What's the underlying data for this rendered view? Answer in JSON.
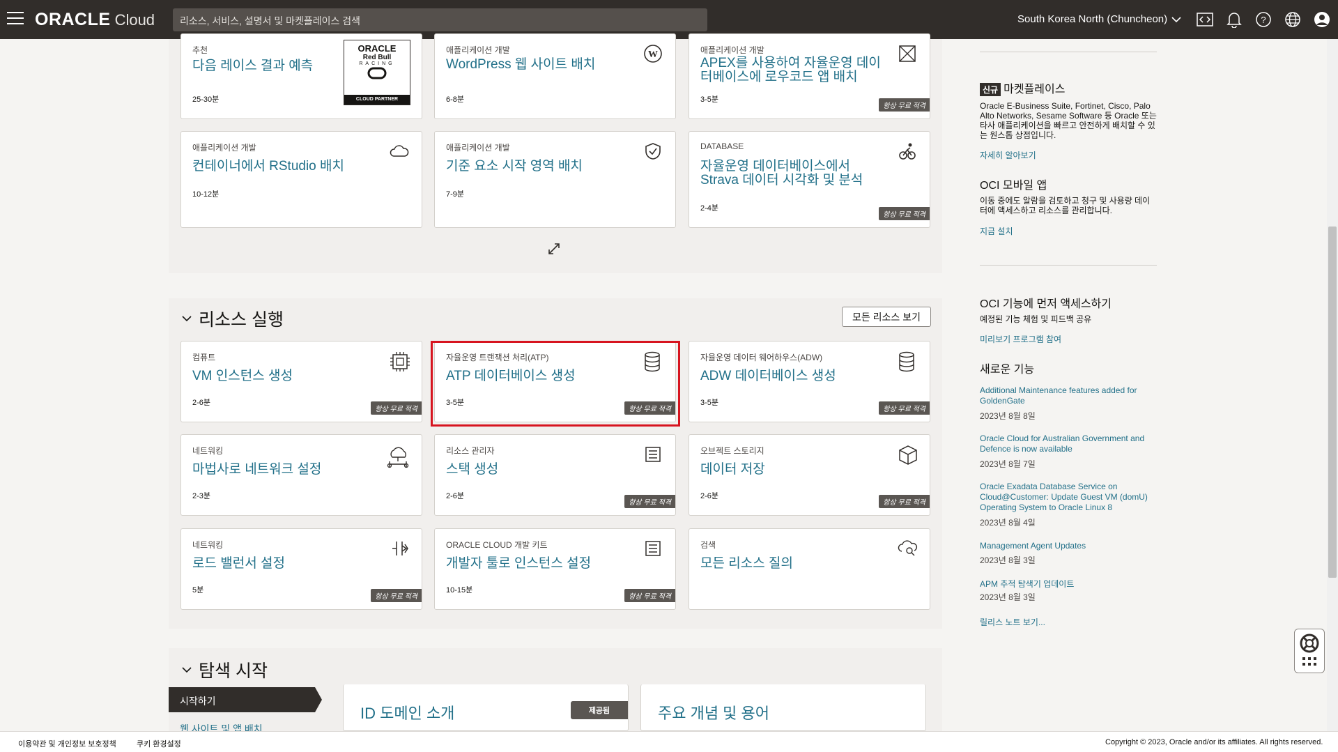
{
  "header": {
    "logo_text": "ORACLE",
    "logo_sub": "Cloud",
    "search_placeholder": "리소스, 서비스, 설명서 및 마켓플레이스 검색",
    "region": "South Korea North (Chuncheon)"
  },
  "quickstart_cards_top": [
    {
      "category": "추천",
      "title": "다음 레이스 결과 예측",
      "time": "25-30분",
      "badge": "",
      "icon": "oracle-redbull-racing-logo"
    },
    {
      "category": "애플리케이션 개발",
      "title": "WordPress 웹 사이트 배치",
      "time": "6-8분",
      "badge": "",
      "icon": "wordpress-icon"
    },
    {
      "category": "애플리케이션 개발",
      "title": "APEX를 사용하여 자율운영 데이터베이스에 로우코드 앱 배치",
      "time": "3-5분",
      "badge": "항상 무료 적격",
      "icon": "apex-icon"
    },
    {
      "category": "애플리케이션 개발",
      "title": "컨테이너에서 RStudio 배치",
      "time": "10-12분",
      "badge": "",
      "icon": "cloud-icon"
    },
    {
      "category": "애플리케이션 개발",
      "title": "기준 요소 시작 영역 배치",
      "time": "7-9분",
      "badge": "",
      "icon": "shield-icon"
    },
    {
      "category": "DATABASE",
      "title": "자율운영 데이터베이스에서 Strava 데이터 시각화 및 분석",
      "time": "2-4분",
      "badge": "항상 무료 적격",
      "icon": "cyclist-icon"
    }
  ],
  "resources_section": {
    "title": "리소스 실행",
    "view_all_button": "모든 리소스 보기",
    "cards": [
      {
        "category": "컴퓨트",
        "title": "VM 인스턴스 생성",
        "time": "2-6분",
        "badge": "항상 무료 적격",
        "icon": "chip-icon"
      },
      {
        "category": "자율운영 트랜잭션 처리(ATP)",
        "title": "ATP 데이터베이스 생성",
        "time": "3-5분",
        "badge": "항상 무료 적격",
        "icon": "database-icon"
      },
      {
        "category": "자율운영 데이터 웨어하우스(ADW)",
        "title": "ADW 데이터베이스 생성",
        "time": "3-5분",
        "badge": "항상 무료 적격",
        "icon": "database-icon"
      },
      {
        "category": "네트워킹",
        "title": "마법사로 네트워크 설정",
        "time": "2-3분",
        "badge": "",
        "icon": "network-icon"
      },
      {
        "category": "리소스 관리자",
        "title": "스택 생성",
        "time": "2-6분",
        "badge": "항상 무료 적격",
        "icon": "stack-icon"
      },
      {
        "category": "오브젝트 스토리지",
        "title": "데이터 저장",
        "time": "2-6분",
        "badge": "항상 무료 적격",
        "icon": "box-icon"
      },
      {
        "category": "네트워킹",
        "title": "로드 밸런서 설정",
        "time": "5분",
        "badge": "항상 무료 적격",
        "icon": "load-balancer-icon"
      },
      {
        "category": "ORACLE CLOUD 개발 키트",
        "title": "개발자 툴로 인스턴스 설정",
        "time": "10-15분",
        "badge": "항상 무료 적격",
        "icon": "stack-icon"
      },
      {
        "category": "검색",
        "title": "모든 리소스 질의",
        "time": "",
        "badge": "",
        "icon": "cloud-search-icon"
      }
    ]
  },
  "explore_section": {
    "title": "탐색 시작",
    "nav_active": "시작하기",
    "nav_link": "웹 사이트 및 앱 배치",
    "cards": [
      {
        "title": "ID 도메인 소개",
        "pill": "제공됨"
      },
      {
        "title": "주요 개념 및 용어",
        "pill": ""
      }
    ]
  },
  "right_panel": {
    "marketplace_badge": "신규",
    "marketplace_title": "마켓플레이스",
    "marketplace_text": "Oracle E-Business Suite, Fortinet, Cisco, Palo Alto Networks, Sesame Software 등 Oracle 또는 타사 애플리케이션을 빠르고 안전하게 배치할 수 있는 원스톱 상점입니다.",
    "marketplace_link": "자세히 알아보기",
    "mobile_title": "OCI 모바일 앱",
    "mobile_text": "이동 중에도 알람을 검토하고 청구 및 사용량 데이터에 액세스하고 리소스를 관리합니다.",
    "mobile_link": "지금 설치",
    "preview_title": "OCI 기능에 먼저 액세스하기",
    "preview_text": "예정된 기능 체험 및 피드백 공유",
    "preview_link": "미리보기 프로그램 참여",
    "whatsnew_title": "새로운 기능",
    "news": [
      {
        "title": "Additional Maintenance features added for GoldenGate",
        "date": "2023년 8월 8일"
      },
      {
        "title": "Oracle Cloud for Australian Government and Defence is now available",
        "date": "2023년 8월 7일"
      },
      {
        "title": "Oracle Exadata Database Service on Cloud@Customer: Update Guest VM (domU) Operating System to Oracle Linux 8",
        "date": "2023년 8월 4일"
      },
      {
        "title": "Management Agent Updates",
        "date": "2023년 8월 3일"
      },
      {
        "title": "APM 추적 탐색기 업데이트",
        "date": "2023년 8월 3일"
      }
    ],
    "release_notes_link": "릴리스 노트 보기..."
  },
  "footer": {
    "terms": "이용약관 및 개인정보 보호정책",
    "cookies": "쿠키 환경설정",
    "copyright": "Copyright © 2023, Oracle and/or its affiliates. All rights reserved."
  }
}
